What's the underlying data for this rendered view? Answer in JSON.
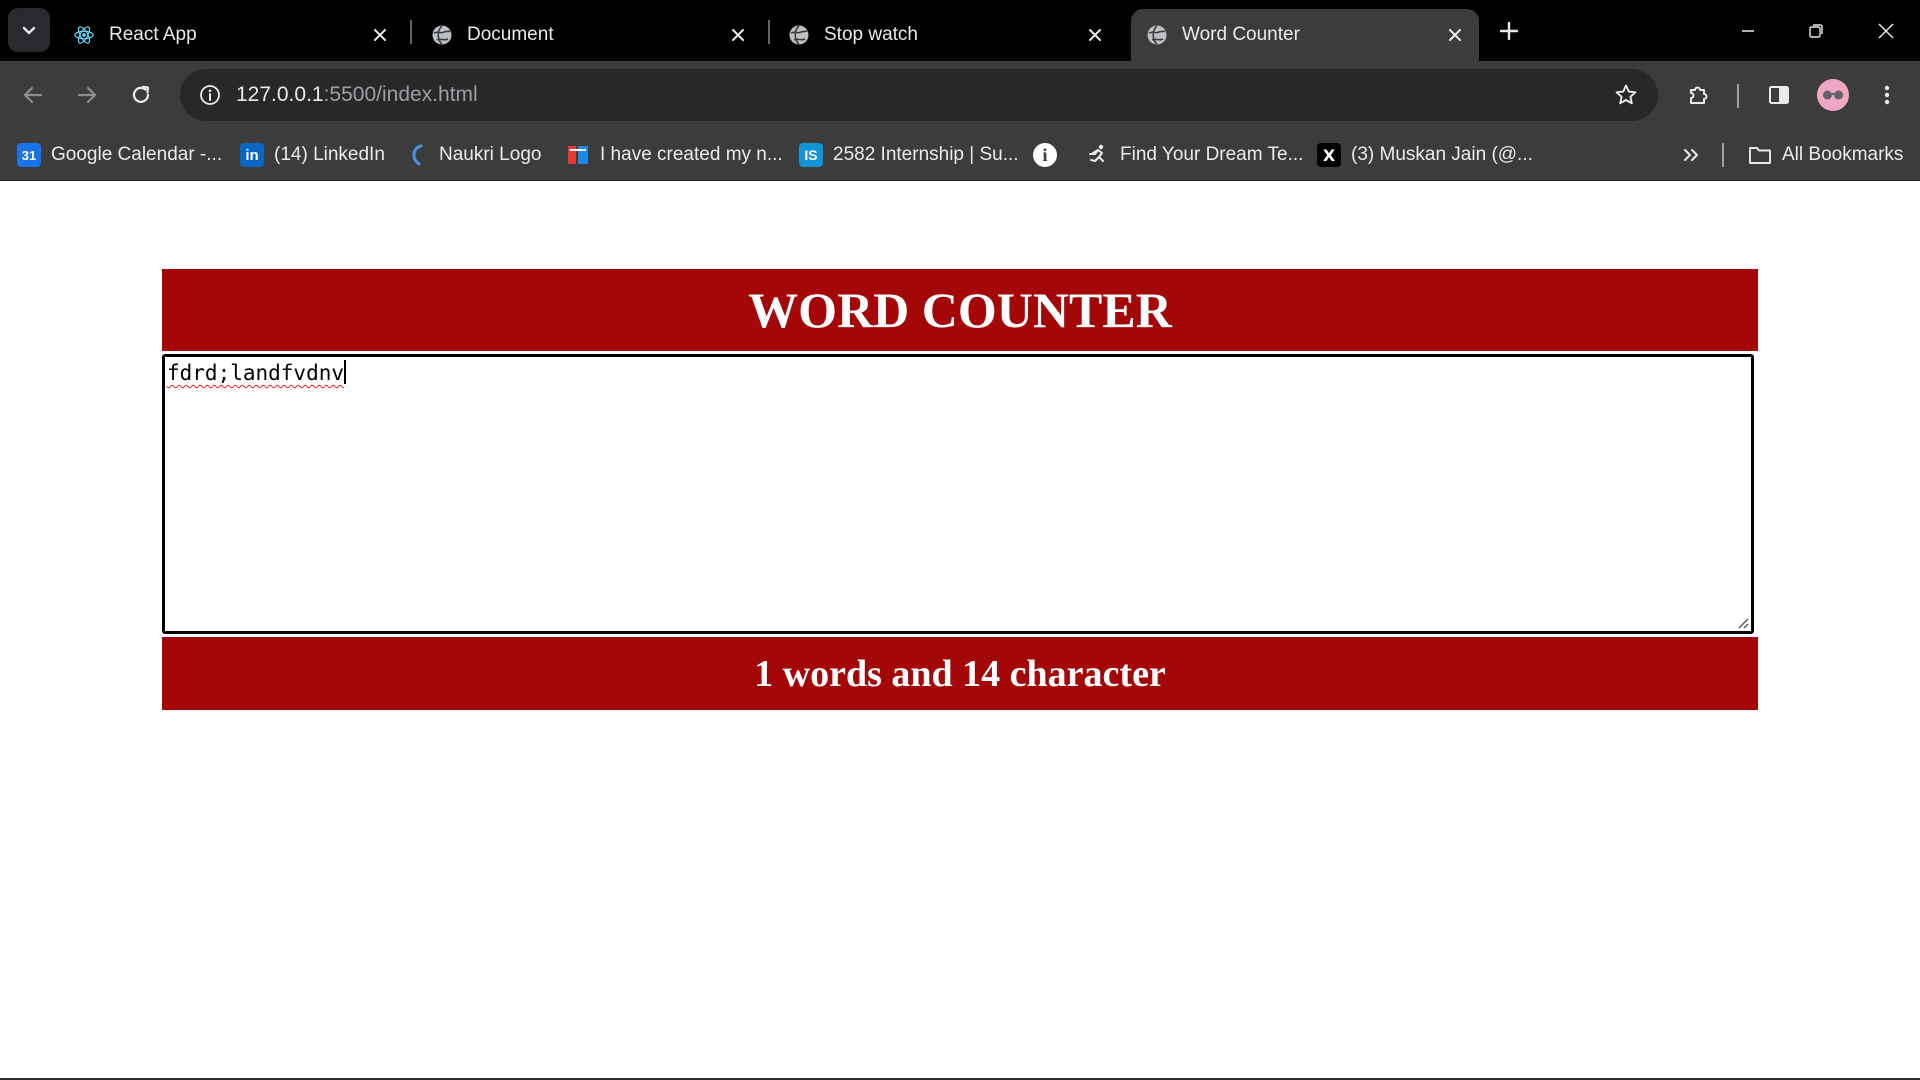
{
  "browser": {
    "tabs": [
      {
        "title": "React App",
        "icon": "react-icon",
        "active": false
      },
      {
        "title": "Document",
        "icon": "globe-icon",
        "active": false
      },
      {
        "title": "Stop watch",
        "icon": "globe-icon",
        "active": false
      },
      {
        "title": "Word Counter",
        "icon": "globe-icon",
        "active": true
      }
    ],
    "url_host": "127.0.0.1",
    "url_rest": ":5500/index.html",
    "bookmarks": [
      {
        "label": "Google Calendar -...",
        "icon": "google-calendar-icon",
        "icon_text": "31",
        "color": "#1a73e8"
      },
      {
        "label": "(14) LinkedIn",
        "icon": "linkedin-icon",
        "icon_text": "in",
        "color": "#0a66c2"
      },
      {
        "label": "Naukri Logo",
        "icon": "naukri-icon",
        "icon_text": "",
        "color": "#4a90e2"
      },
      {
        "label": "I have created my n...",
        "icon": "bookmark-site-icon",
        "icon_text": "T",
        "color": "#e53935"
      },
      {
        "label": "2582 Internship | Su...",
        "icon": "internshala-icon",
        "icon_text": "IS",
        "color": "#1295d8"
      },
      {
        "label": "",
        "icon": "info-icon",
        "icon_text": "i",
        "color": "#ffffff"
      },
      {
        "label": "Find Your Dream Te...",
        "icon": "runner-icon",
        "icon_text": "",
        "color": "#e8eaed"
      },
      {
        "label": "(3) Muskan Jain (@...",
        "icon": "x-icon",
        "icon_text": "X",
        "color": "#000000"
      }
    ],
    "all_bookmarks": "All Bookmarks"
  },
  "app": {
    "title": "WORD COUNTER",
    "textarea_value": "fdrd;landfvdnv",
    "result": "1 words and 14 character"
  },
  "colors": {
    "accent": "#a30707",
    "tab_strip": "#000000",
    "toolbar": "#3c3c3c"
  }
}
